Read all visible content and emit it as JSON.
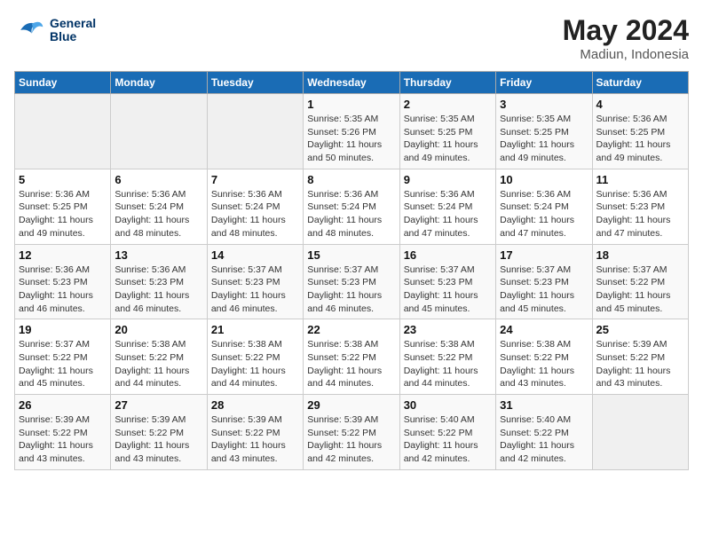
{
  "header": {
    "logo_line1": "General",
    "logo_line2": "Blue",
    "month_year": "May 2024",
    "location": "Madiun, Indonesia"
  },
  "weekdays": [
    "Sunday",
    "Monday",
    "Tuesday",
    "Wednesday",
    "Thursday",
    "Friday",
    "Saturday"
  ],
  "weeks": [
    [
      {
        "day": "",
        "detail": ""
      },
      {
        "day": "",
        "detail": ""
      },
      {
        "day": "",
        "detail": ""
      },
      {
        "day": "1",
        "detail": "Sunrise: 5:35 AM\nSunset: 5:26 PM\nDaylight: 11 hours\nand 50 minutes."
      },
      {
        "day": "2",
        "detail": "Sunrise: 5:35 AM\nSunset: 5:25 PM\nDaylight: 11 hours\nand 49 minutes."
      },
      {
        "day": "3",
        "detail": "Sunrise: 5:35 AM\nSunset: 5:25 PM\nDaylight: 11 hours\nand 49 minutes."
      },
      {
        "day": "4",
        "detail": "Sunrise: 5:36 AM\nSunset: 5:25 PM\nDaylight: 11 hours\nand 49 minutes."
      }
    ],
    [
      {
        "day": "5",
        "detail": "Sunrise: 5:36 AM\nSunset: 5:25 PM\nDaylight: 11 hours\nand 49 minutes."
      },
      {
        "day": "6",
        "detail": "Sunrise: 5:36 AM\nSunset: 5:24 PM\nDaylight: 11 hours\nand 48 minutes."
      },
      {
        "day": "7",
        "detail": "Sunrise: 5:36 AM\nSunset: 5:24 PM\nDaylight: 11 hours\nand 48 minutes."
      },
      {
        "day": "8",
        "detail": "Sunrise: 5:36 AM\nSunset: 5:24 PM\nDaylight: 11 hours\nand 48 minutes."
      },
      {
        "day": "9",
        "detail": "Sunrise: 5:36 AM\nSunset: 5:24 PM\nDaylight: 11 hours\nand 47 minutes."
      },
      {
        "day": "10",
        "detail": "Sunrise: 5:36 AM\nSunset: 5:24 PM\nDaylight: 11 hours\nand 47 minutes."
      },
      {
        "day": "11",
        "detail": "Sunrise: 5:36 AM\nSunset: 5:23 PM\nDaylight: 11 hours\nand 47 minutes."
      }
    ],
    [
      {
        "day": "12",
        "detail": "Sunrise: 5:36 AM\nSunset: 5:23 PM\nDaylight: 11 hours\nand 46 minutes."
      },
      {
        "day": "13",
        "detail": "Sunrise: 5:36 AM\nSunset: 5:23 PM\nDaylight: 11 hours\nand 46 minutes."
      },
      {
        "day": "14",
        "detail": "Sunrise: 5:37 AM\nSunset: 5:23 PM\nDaylight: 11 hours\nand 46 minutes."
      },
      {
        "day": "15",
        "detail": "Sunrise: 5:37 AM\nSunset: 5:23 PM\nDaylight: 11 hours\nand 46 minutes."
      },
      {
        "day": "16",
        "detail": "Sunrise: 5:37 AM\nSunset: 5:23 PM\nDaylight: 11 hours\nand 45 minutes."
      },
      {
        "day": "17",
        "detail": "Sunrise: 5:37 AM\nSunset: 5:23 PM\nDaylight: 11 hours\nand 45 minutes."
      },
      {
        "day": "18",
        "detail": "Sunrise: 5:37 AM\nSunset: 5:22 PM\nDaylight: 11 hours\nand 45 minutes."
      }
    ],
    [
      {
        "day": "19",
        "detail": "Sunrise: 5:37 AM\nSunset: 5:22 PM\nDaylight: 11 hours\nand 45 minutes."
      },
      {
        "day": "20",
        "detail": "Sunrise: 5:38 AM\nSunset: 5:22 PM\nDaylight: 11 hours\nand 44 minutes."
      },
      {
        "day": "21",
        "detail": "Sunrise: 5:38 AM\nSunset: 5:22 PM\nDaylight: 11 hours\nand 44 minutes."
      },
      {
        "day": "22",
        "detail": "Sunrise: 5:38 AM\nSunset: 5:22 PM\nDaylight: 11 hours\nand 44 minutes."
      },
      {
        "day": "23",
        "detail": "Sunrise: 5:38 AM\nSunset: 5:22 PM\nDaylight: 11 hours\nand 44 minutes."
      },
      {
        "day": "24",
        "detail": "Sunrise: 5:38 AM\nSunset: 5:22 PM\nDaylight: 11 hours\nand 43 minutes."
      },
      {
        "day": "25",
        "detail": "Sunrise: 5:39 AM\nSunset: 5:22 PM\nDaylight: 11 hours\nand 43 minutes."
      }
    ],
    [
      {
        "day": "26",
        "detail": "Sunrise: 5:39 AM\nSunset: 5:22 PM\nDaylight: 11 hours\nand 43 minutes."
      },
      {
        "day": "27",
        "detail": "Sunrise: 5:39 AM\nSunset: 5:22 PM\nDaylight: 11 hours\nand 43 minutes."
      },
      {
        "day": "28",
        "detail": "Sunrise: 5:39 AM\nSunset: 5:22 PM\nDaylight: 11 hours\nand 43 minutes."
      },
      {
        "day": "29",
        "detail": "Sunrise: 5:39 AM\nSunset: 5:22 PM\nDaylight: 11 hours\nand 42 minutes."
      },
      {
        "day": "30",
        "detail": "Sunrise: 5:40 AM\nSunset: 5:22 PM\nDaylight: 11 hours\nand 42 minutes."
      },
      {
        "day": "31",
        "detail": "Sunrise: 5:40 AM\nSunset: 5:22 PM\nDaylight: 11 hours\nand 42 minutes."
      },
      {
        "day": "",
        "detail": ""
      }
    ]
  ]
}
